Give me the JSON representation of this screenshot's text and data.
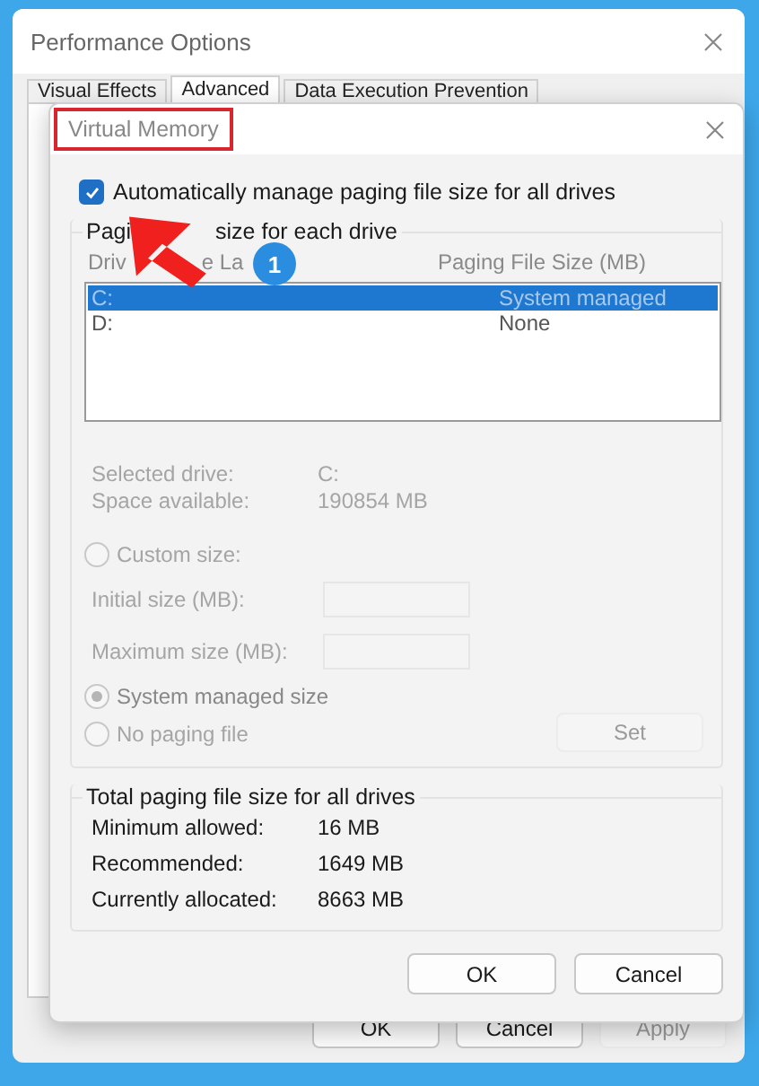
{
  "window": {
    "title": "Performance Options"
  },
  "tabs": [
    {
      "label": "Visual Effects",
      "selected": false
    },
    {
      "label": "Advanced",
      "selected": true
    },
    {
      "label": "Data Execution Prevention",
      "selected": false
    }
  ],
  "buttons": [
    {
      "label": "OK",
      "disabled": false
    },
    {
      "label": "Cancel",
      "disabled": false
    },
    {
      "label": "Apply",
      "disabled": true
    }
  ],
  "dialog": {
    "title": "Virtual Memory",
    "auto_manage": {
      "label": "Automatically manage paging file size for all drives",
      "checked": true
    },
    "drives_group": {
      "label_parts": [
        "Pagi",
        "size for each drive"
      ],
      "columns": [
        [
          "Driv",
          "e La"
        ],
        [
          "Paging File Size (MB)"
        ]
      ],
      "rows": [
        {
          "drive": "C:",
          "size": "System managed",
          "selected": true
        },
        {
          "drive": "D:",
          "size": "None",
          "selected": false
        }
      ],
      "details": [
        {
          "label": "Selected drive:",
          "value": "C:"
        },
        {
          "label": "Space available:",
          "value": "190854 MB"
        }
      ],
      "options": [
        {
          "kind": "radio",
          "label": "Custom size:",
          "selected": false,
          "disabled": true
        },
        {
          "kind": "field",
          "label": "Initial size (MB):",
          "disabled": true
        },
        {
          "kind": "field",
          "label": "Maximum size (MB):",
          "disabled": true
        },
        {
          "kind": "radio",
          "label": "System managed size",
          "selected": true,
          "disabled": true
        },
        {
          "kind": "radio",
          "label": "No paging file",
          "selected": false,
          "disabled": true
        }
      ],
      "set_button": {
        "label": "Set",
        "disabled": true
      }
    },
    "totals_group": {
      "label": "Total paging file size for all drives",
      "rows": [
        {
          "label": "Minimum allowed:",
          "value": "16 MB"
        },
        {
          "label": "Recommended:",
          "value": "1649 MB"
        },
        {
          "label": "Currently allocated:",
          "value": "8663 MB"
        }
      ]
    },
    "buttons": [
      {
        "label": "OK"
      },
      {
        "label": "Cancel"
      }
    ]
  },
  "annotation": {
    "badge": "1"
  }
}
